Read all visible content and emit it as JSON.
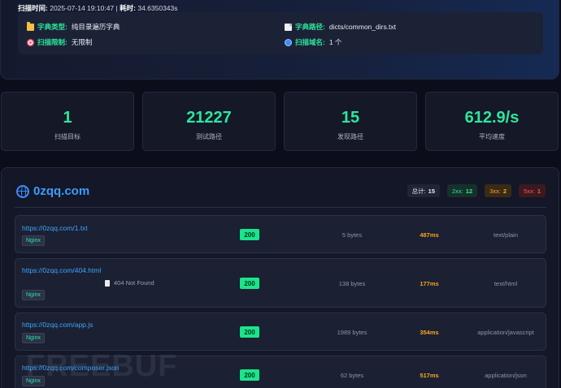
{
  "scan_meta": {
    "time_label": "扫描时间:",
    "time_value": "2025-07-14 19:10:47",
    "separator": "|",
    "elapsed_label": "耗时:",
    "elapsed_value": "34.6350343s"
  },
  "info": {
    "dict_type_label": "字典类型:",
    "dict_type_value": "纯目录遍历字典",
    "dict_path_label": "字典路径:",
    "dict_path_value": "dicts/common_dirs.txt",
    "scan_limit_label": "扫描限制:",
    "scan_limit_value": "无限制",
    "scan_domains_label": "扫描域名:",
    "scan_domains_value": "1 个"
  },
  "stats": [
    {
      "value": "1",
      "label": "扫描目标"
    },
    {
      "value": "21227",
      "label": "测试路径"
    },
    {
      "value": "15",
      "label": "发现路径"
    },
    {
      "value": "612.9/s",
      "label": "平均速度"
    }
  ],
  "domain": {
    "name": "0zqq.com",
    "total_label": "总计:",
    "total_value": "15",
    "s2_label": "2xx:",
    "s2_value": "12",
    "s3_label": "3xx:",
    "s3_value": "2",
    "s5_label": "5xx:",
    "s5_value": "1"
  },
  "results": [
    {
      "url": "https://0zqq.com/1.txt",
      "server": "Nginx",
      "title": "",
      "status": "200",
      "size": "5 bytes",
      "time": "487ms",
      "content_type": "text/plain"
    },
    {
      "url": "https://0zqq.com/404.html",
      "server": "Nginx",
      "title": "404 Not Found",
      "status": "200",
      "size": "138 bytes",
      "time": "177ms",
      "content_type": "text/html"
    },
    {
      "url": "https://0zqq.com/app.js",
      "server": "Nginx",
      "title": "",
      "status": "200",
      "size": "1989 bytes",
      "time": "354ms",
      "content_type": "application/javascript"
    },
    {
      "url": "https://0zqq.com/composer.json",
      "server": "Nginx",
      "title": "",
      "status": "200",
      "size": "62 bytes",
      "time": "517ms",
      "content_type": "application/json"
    }
  ],
  "watermark": "FREEBUF",
  "colors": {
    "accent_green": "#2ee59d",
    "status_ok": "#19e58a",
    "link_blue": "#3da5ff",
    "time_orange": "#f5a623",
    "error_red": "#ff4f5e"
  }
}
